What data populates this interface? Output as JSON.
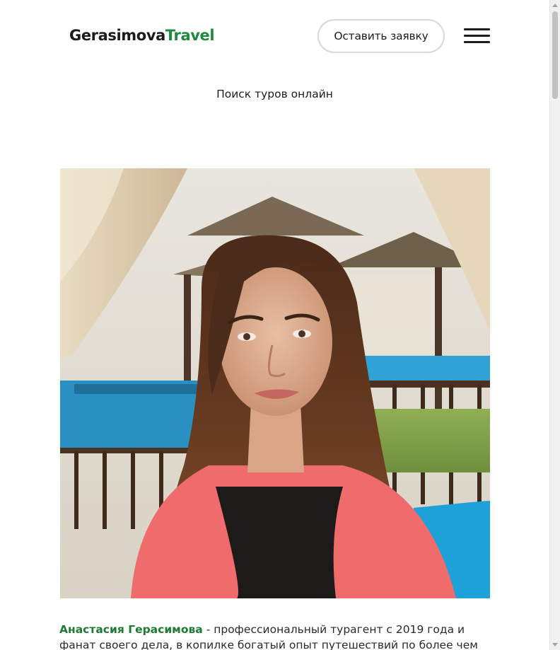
{
  "header": {
    "logo_part_a": "Gerasimova",
    "logo_part_b": "Travel",
    "cta_label": "Оставить заявку",
    "menu_icon": "hamburger-menu-icon",
    "search_link": "Поиск туров онлайн"
  },
  "photo": {
    "subject": "portrait-photo"
  },
  "bio": {
    "name": "Анастасия Герасимова",
    "text": " - профессиональный турагент с 2019 года и фанат своего дела, в копилке богатый опыт путешествий по более чем двадцати"
  },
  "colors": {
    "brand_green": "#1f8a3b",
    "text_dark": "#1c1c1c"
  }
}
